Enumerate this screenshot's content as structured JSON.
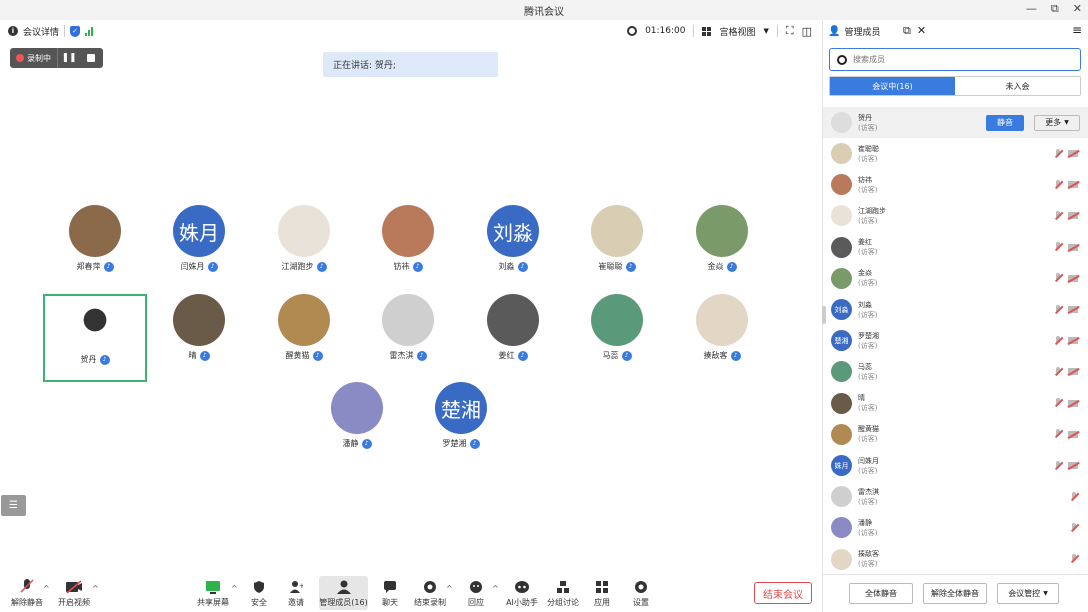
{
  "window": {
    "title": "腾讯会议",
    "controls": [
      "—",
      "⧉",
      "✕"
    ]
  },
  "topbar": {
    "meeting_info": "会议详情",
    "timer": "01:16:00",
    "view_mode": "宫格视图"
  },
  "recording": {
    "label": "录制中"
  },
  "speaking": {
    "text": "正在讲话: 贺丹;"
  },
  "gallery": [
    {
      "name": "郑春萍",
      "avatar": "",
      "color": "#8a6a4a"
    },
    {
      "name": "闫姝月",
      "avatar": "姝月",
      "color": "#3a6bc4"
    },
    {
      "name": "江湖跑步",
      "avatar": "",
      "color": "#e8e2d8"
    },
    {
      "name": "钫祎",
      "avatar": "",
      "color": "#b87a5a"
    },
    {
      "name": "刘淼",
      "avatar": "刘淼",
      "color": "#3a6bc4"
    },
    {
      "name": "崔聪聪",
      "avatar": "",
      "color": "#d9cdb4"
    },
    {
      "name": "金焱",
      "avatar": "",
      "color": "#7a9a6a"
    },
    {
      "name": "贺丹",
      "avatar": "",
      "color": "#ffffff"
    },
    {
      "name": "晴",
      "avatar": "",
      "color": "#6a5a48"
    },
    {
      "name": "醒黄猫",
      "avatar": "",
      "color": "#b08a50"
    },
    {
      "name": "雷杰淇",
      "avatar": "",
      "color": "#cfcfcf"
    },
    {
      "name": "姜红",
      "avatar": "",
      "color": "#5a5a5a"
    },
    {
      "name": "马蕊",
      "avatar": "",
      "color": "#5a9a7a"
    },
    {
      "name": "揍敌客",
      "avatar": "",
      "color": "#e2d6c4"
    },
    {
      "name": "潘静",
      "avatar": "",
      "color": "#8a8ac4"
    },
    {
      "name": "罗楚湘",
      "avatar": "楚湘",
      "color": "#3a6bc4"
    }
  ],
  "toolbar": {
    "unmute": "解除静音",
    "start_video": "开启视频",
    "share_screen": "共享屏幕",
    "security": "安全",
    "invite": "邀请",
    "manage_members": "管理成员(16)",
    "chat": "聊天",
    "stop_recording": "结束录制",
    "reactions": "回应",
    "ai_assistant": "AI小助手",
    "breakout": "分组讨论",
    "apps": "应用",
    "settings": "设置",
    "end_meeting": "结束会议"
  },
  "panel": {
    "title": "管理成员",
    "search_placeholder": "搜索成员",
    "tab_in_meeting": "会议中(16)",
    "tab_not_joined": "未入会",
    "mute_btn": "静音",
    "more_btn": "更多",
    "members": [
      {
        "name": "贺丹",
        "role": "(访客)",
        "avatar": "",
        "color": "#dddddd",
        "cam": false
      },
      {
        "name": "崔聪聪",
        "role": "(访客)",
        "avatar": "",
        "color": "#d9cdb4",
        "cam": true
      },
      {
        "name": "钫祎",
        "role": "(访客)",
        "avatar": "",
        "color": "#b87a5a",
        "cam": true
      },
      {
        "name": "江湖跑步",
        "role": "(访客)",
        "avatar": "",
        "color": "#e8e2d8",
        "cam": true
      },
      {
        "name": "姜红",
        "role": "(访客)",
        "avatar": "",
        "color": "#5a5a5a",
        "cam": true
      },
      {
        "name": "金焱",
        "role": "(访客)",
        "avatar": "",
        "color": "#7a9a6a",
        "cam": true
      },
      {
        "name": "刘淼",
        "role": "(访客)",
        "avatar": "刘淼",
        "color": "#3a6bc4",
        "cam": true
      },
      {
        "name": "罗楚湘",
        "role": "(访客)",
        "avatar": "楚湘",
        "color": "#3a6bc4",
        "cam": true
      },
      {
        "name": "马蕊",
        "role": "(访客)",
        "avatar": "",
        "color": "#5a9a7a",
        "cam": true
      },
      {
        "name": "晴",
        "role": "(访客)",
        "avatar": "",
        "color": "#6a5a48",
        "cam": true
      },
      {
        "name": "醒黄猫",
        "role": "(访客)",
        "avatar": "",
        "color": "#b08a50",
        "cam": true
      },
      {
        "name": "闫姝月",
        "role": "(访客)",
        "avatar": "姝月",
        "color": "#3a6bc4",
        "cam": true
      },
      {
        "name": "雷杰淇",
        "role": "(访客)",
        "avatar": "",
        "color": "#cfcfcf",
        "cam": false
      },
      {
        "name": "潘静",
        "role": "(访客)",
        "avatar": "",
        "color": "#8a8ac4",
        "cam": false
      },
      {
        "name": "揍敌客",
        "role": "(访客)",
        "avatar": "",
        "color": "#e2d6c4",
        "cam": false
      }
    ],
    "mute_all": "全体静音",
    "unmute_all": "解除全体静音",
    "meeting_control": "会议管控"
  }
}
